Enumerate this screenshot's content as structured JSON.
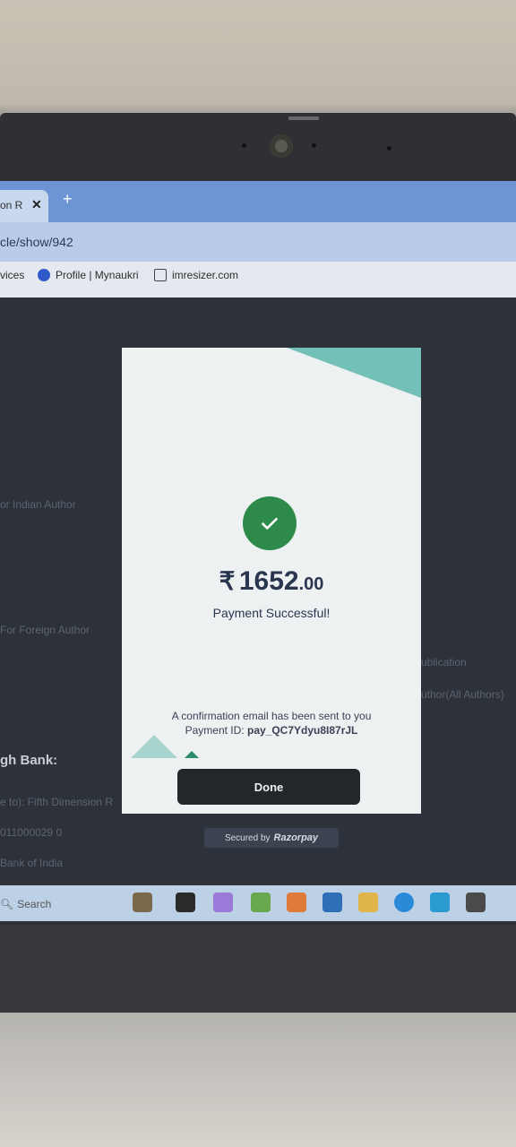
{
  "browser": {
    "tab_title": "on R",
    "tab_close": "✕",
    "new_tab": "+",
    "url": "cle/show/942",
    "bookmarks": [
      {
        "label": "vices"
      },
      {
        "label": "Profile | Mynaukri"
      },
      {
        "label": "imresizer.com"
      }
    ]
  },
  "background_page": {
    "labels": [
      "gh Bank:",
      "e to): Fifth Dimension R",
      "011000029 0",
      "Bank of India"
    ],
    "faint_texts": [
      "or Indian Author",
      "For Foreign Author",
      "Publication",
      "Author(All Authors)"
    ]
  },
  "payment": {
    "currency": "₹",
    "amount_main": "1652",
    "amount_decimal": ".00",
    "status": "Payment Successful!",
    "confirmation": "A confirmation email has been sent to you",
    "payment_id_label": "Payment ID:",
    "payment_id": "pay_QC7Ydyu8I87rJL",
    "done_label": "Done",
    "secured_by": "Secured by",
    "provider": "Razorpay",
    "accent_color": "#2e8a4a"
  },
  "taskbar": {
    "search_placeholder": "Search"
  }
}
